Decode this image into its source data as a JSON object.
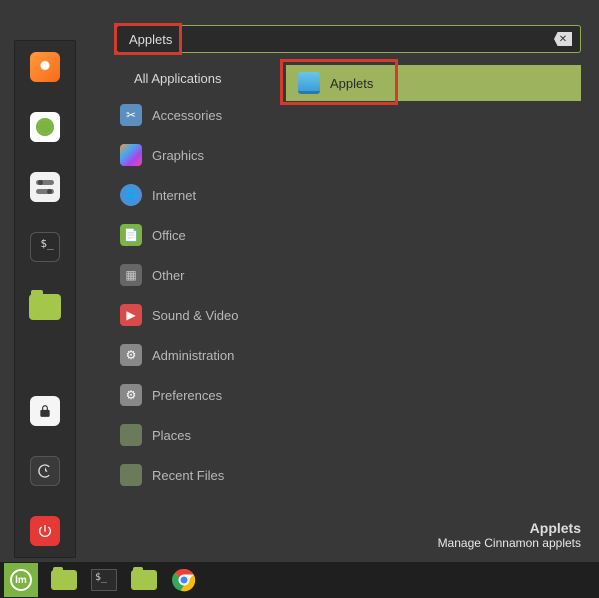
{
  "search": {
    "value": "Applets"
  },
  "categories": [
    {
      "label": "All Applications",
      "icon": ""
    },
    {
      "label": "Accessories",
      "icon": "acc"
    },
    {
      "label": "Graphics",
      "icon": "gfx"
    },
    {
      "label": "Internet",
      "icon": "net"
    },
    {
      "label": "Office",
      "icon": "off"
    },
    {
      "label": "Other",
      "icon": "oth"
    },
    {
      "label": "Sound & Video",
      "icon": "snd"
    },
    {
      "label": "Administration",
      "icon": "adm"
    },
    {
      "label": "Preferences",
      "icon": "prf"
    },
    {
      "label": "Places",
      "icon": "plc"
    },
    {
      "label": "Recent Files",
      "icon": "rec"
    }
  ],
  "results": [
    {
      "label": "Applets"
    }
  ],
  "hint": {
    "title": "Applets",
    "description": "Manage Cinnamon applets"
  },
  "favorites": {
    "top": [
      "firefox",
      "software",
      "settings",
      "terminal",
      "files"
    ],
    "bottom": [
      "lock",
      "logout",
      "power"
    ]
  },
  "taskbar": [
    "mint-menu",
    "show-desktop",
    "terminal",
    "files",
    "chrome"
  ]
}
